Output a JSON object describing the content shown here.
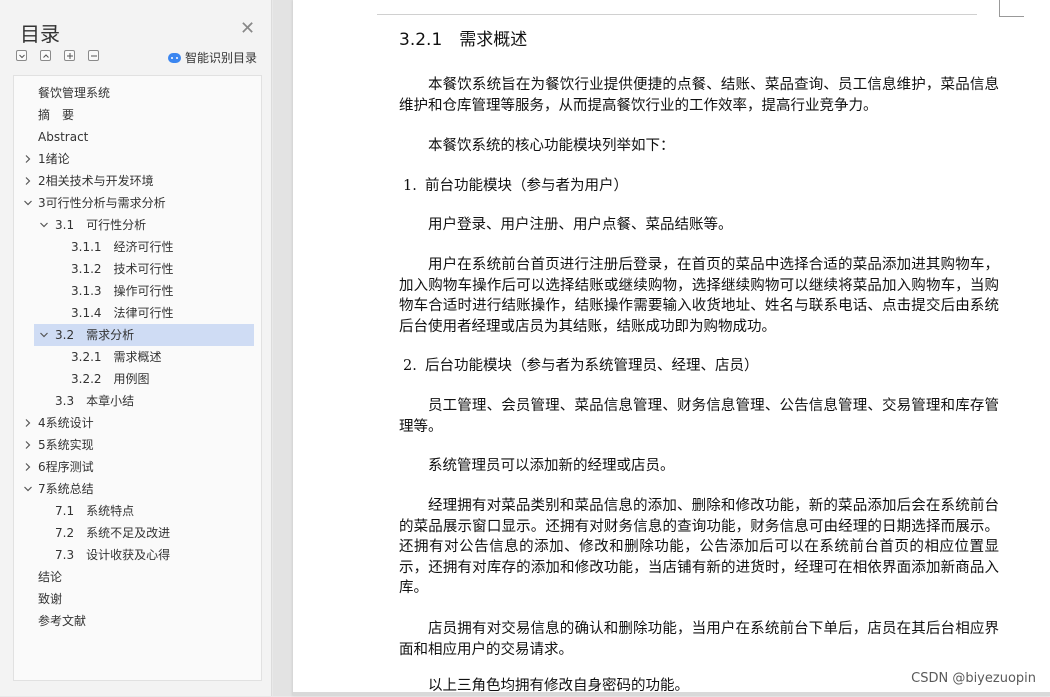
{
  "toc": {
    "title": "目录",
    "smart_label": "智能识别目录",
    "items": [
      {
        "label": "餐饮管理系统",
        "level": 0,
        "chevron": "none"
      },
      {
        "label": "摘　要",
        "level": 0,
        "chevron": "none"
      },
      {
        "label": "Abstract",
        "level": 0,
        "chevron": "none"
      },
      {
        "label": "1绪论",
        "level": 0,
        "chevron": "right"
      },
      {
        "label": "2相关技术与开发环境",
        "level": 0,
        "chevron": "right"
      },
      {
        "label": "3可行性分析与需求分析",
        "level": 0,
        "chevron": "down"
      },
      {
        "label": "3.1　可行性分析",
        "level": 1,
        "chevron": "down"
      },
      {
        "label": "3.1.1　经济可行性",
        "level": 2,
        "chevron": "none"
      },
      {
        "label": "3.1.2　技术可行性",
        "level": 2,
        "chevron": "none"
      },
      {
        "label": "3.1.3　操作可行性",
        "level": 2,
        "chevron": "none"
      },
      {
        "label": "3.1.4　法律可行性",
        "level": 2,
        "chevron": "none"
      },
      {
        "label": "3.2　需求分析",
        "level": 1,
        "chevron": "down",
        "selected": true
      },
      {
        "label": "3.2.1　需求概述",
        "level": 2,
        "chevron": "none"
      },
      {
        "label": "3.2.2　用例图",
        "level": 2,
        "chevron": "none"
      },
      {
        "label": "3.3　本章小结",
        "level": 1,
        "chevron": "none"
      },
      {
        "label": "4系统设计",
        "level": 0,
        "chevron": "right"
      },
      {
        "label": "5系统实现",
        "level": 0,
        "chevron": "right"
      },
      {
        "label": "6程序测试",
        "level": 0,
        "chevron": "right"
      },
      {
        "label": "7系统总结",
        "level": 0,
        "chevron": "down"
      },
      {
        "label": "7.1　系统特点",
        "level": 1,
        "chevron": "none"
      },
      {
        "label": "7.2　系统不足及改进",
        "level": 1,
        "chevron": "none"
      },
      {
        "label": "7.3　设计收获及心得",
        "level": 1,
        "chevron": "none"
      },
      {
        "label": "结论",
        "level": 0,
        "chevron": "none"
      },
      {
        "label": "致谢",
        "level": 0,
        "chevron": "none"
      },
      {
        "label": "参考文献",
        "level": 0,
        "chevron": "none"
      }
    ]
  },
  "doc": {
    "heading": "3.2.1　需求概述",
    "p1": "本餐饮系统旨在为餐饮行业提供便捷的点餐、结账、菜品查询、员工信息维护，菜品信息维护和仓库管理等服务，从而提高餐饮行业的工作效率，提高行业竞争力。",
    "p2": "本餐饮系统的核心功能模块列举如下：",
    "li1_num": "1.",
    "li1": "前台功能模块（参与者为用户）",
    "p3": "用户登录、用户注册、用户点餐、菜品结账等。",
    "p4": "用户在系统前台首页进行注册后登录，在首页的菜品中选择合适的菜品添加进其购物车，加入购物车操作后可以选择结账或继续购物，选择继续购物可以继续将菜品加入购物车，当购物车合适时进行结账操作，结账操作需要输入收货地址、姓名与联系电话、点击提交后由系统后台使用者经理或店员为其结账，结账成功即为购物成功。",
    "li2_num": "2.",
    "li2": "后台功能模块（参与者为系统管理员、经理、店员）",
    "p5": "员工管理、会员管理、菜品信息管理、财务信息管理、公告信息管理、交易管理和库存管理等。",
    "p6": "系统管理员可以添加新的经理或店员。",
    "p7": "经理拥有对菜品类别和菜品信息的添加、删除和修改功能，新的菜品添加后会在系统前台的菜品展示窗口显示。还拥有对财务信息的查询功能，财务信息可由经理的日期选择而展示。还拥有对公告信息的添加、修改和删除功能，公告添加后可以在系统前台首页的相应位置显示，还拥有对库存的添加和修改功能，当店铺有新的进货时，经理可在相依界面添加新商品入库。",
    "p8": "店员拥有对交易信息的确认和删除功能，当用户在系统前台下单后，店员在其后台相应界面和相应用户的交易请求。",
    "p9": "以上三角色均拥有修改自身密码的功能。"
  },
  "watermark": "CSDN @biyezuopin"
}
